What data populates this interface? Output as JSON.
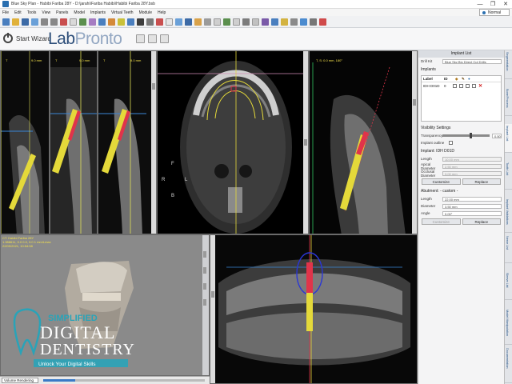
{
  "window": {
    "title": "Blue Sky Plan - Habibi Fariba 28Y - D:\\jarahi\\Fariba Habibi\\Habibi Fariba 28Y.bsb",
    "controls": [
      "—",
      "❐",
      "✕"
    ]
  },
  "menu": [
    "File",
    "Edit",
    "Tools",
    "View",
    "Panels",
    "Model",
    "Implants",
    "Virtual Teeth",
    "Module",
    "Help"
  ],
  "mode": "Normal",
  "wizard": {
    "label": "Start Wizard",
    "brand_first": "Lab",
    "brand_second": "Pronto"
  },
  "viewports": {
    "sections": [
      "T",
      "T",
      "T"
    ],
    "section_dims": [
      "9.0 mm",
      "9.0 mm",
      "9.0 mm"
    ],
    "cross_header": "T, S: 0.0 mm, 180°",
    "orient": {
      "front": "F",
      "right": "R",
      "left": "L",
      "back": "B"
    },
    "ct_info": {
      "line1": "CT: Habibi Fariba 28Y",
      "line2": "1.988611, 0.0 0.0, 0.0 1 mm/Lmax",
      "line3": "22/09/2021, 10:54:58"
    },
    "render_mode": "Volume Rendering",
    "render_level": 0.2
  },
  "panel": {
    "title": "Implant List",
    "drill_kit_label": "Drill Kit",
    "drill_kit_value": "Blue Sky Bio Direct Cut Drills",
    "implants_label": "Implants",
    "table_headers": [
      "Label",
      "ID"
    ],
    "implant_rows": [
      {
        "label": "IDH D01D",
        "id": "0"
      }
    ],
    "visibility_title": "Visibility Settings",
    "transparency_label": "Transparency",
    "transparency_value": "0.50",
    "implant_outline_label": "Implant outline",
    "implant_section_title": "Implant: IDH D01D",
    "implant_fields": [
      {
        "label": "Length",
        "value": "10.00 mm"
      },
      {
        "label": "Apical Diameter",
        "value": "2.50 mm"
      },
      {
        "label": "Occlusal Diameter",
        "value": "3.00 mm"
      }
    ],
    "btn_customize": "Customize",
    "btn_replace": "Replace",
    "abutment_title": "Abutment: - custom -",
    "abutment_fields": [
      {
        "label": "Length",
        "value": "22.00 mm"
      },
      {
        "label": "Diameter",
        "value": "3.50 mm"
      },
      {
        "label": "Angle",
        "value": "0.00°"
      }
    ],
    "btn_customize2": "Customize",
    "btn_replace2": "Replace"
  },
  "side_tabs": [
    "Segmentation",
    "Bone/Process",
    "Implant List",
    "Tooth List",
    "Implant Validations",
    "Nerve List",
    "Sleeve List",
    "Model Manipulation",
    "Documentation"
  ],
  "watermark": {
    "line1": "SIMPLIFIED",
    "line2": "DIGITAL",
    "line3": "DENTISTRY",
    "line4": "Unlock Your Digital Skills"
  },
  "colors": {
    "brand": "#2e4f7a",
    "implant_yellow": "#e4d93a",
    "implant_red": "#e0344a",
    "guide_line": "#3a86d6",
    "watermark_teal": "#29a3b8"
  }
}
